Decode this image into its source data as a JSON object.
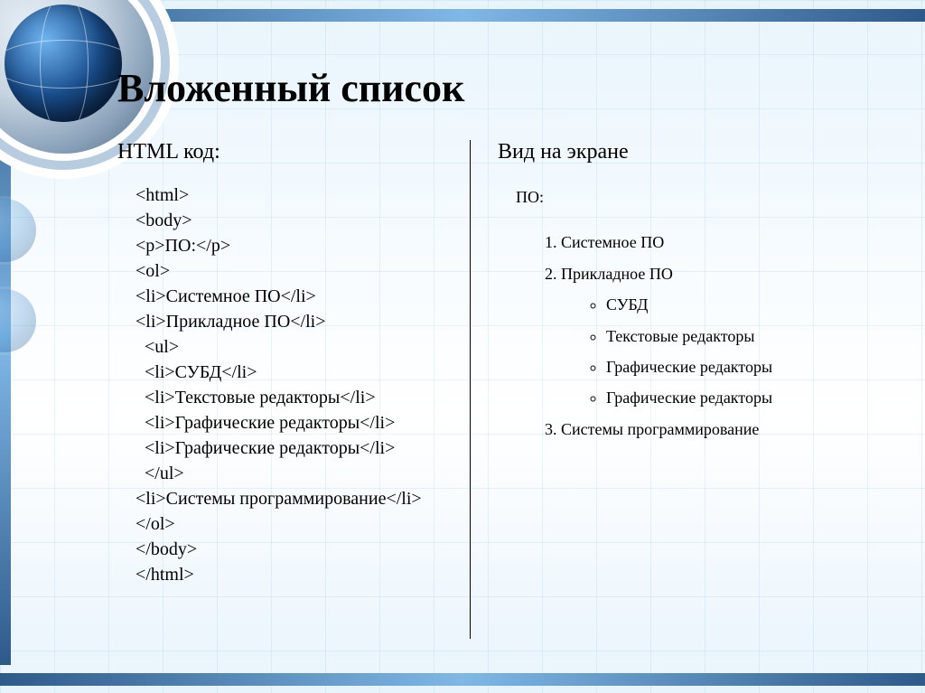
{
  "title": "Вложенный список",
  "left": {
    "header": "HTML код:",
    "code": [
      "<html>",
      "<body>",
      "<p>ПО:</p>",
      "<ol>",
      "<li>Системное ПО</li>",
      "<li>Прикладное ПО</li>",
      "  <ul>",
      "  <li>СУБД</li>",
      "  <li>Текстовые редакторы</li>",
      "  <li>Графические редакторы</li>",
      "  <li>Графические редакторы</li>",
      "  </ul>",
      "<li>Системы программирование</li>",
      "</ol>",
      "</body>",
      "</html>"
    ]
  },
  "right": {
    "header": "Вид на экране",
    "label": "ПО:",
    "items": [
      "Системное ПО",
      "Прикладное ПО"
    ],
    "subitems": [
      "СУБД",
      "Текстовые редакторы",
      "Графические редакторы",
      "Графические редакторы"
    ],
    "after": "Системы программирование"
  }
}
